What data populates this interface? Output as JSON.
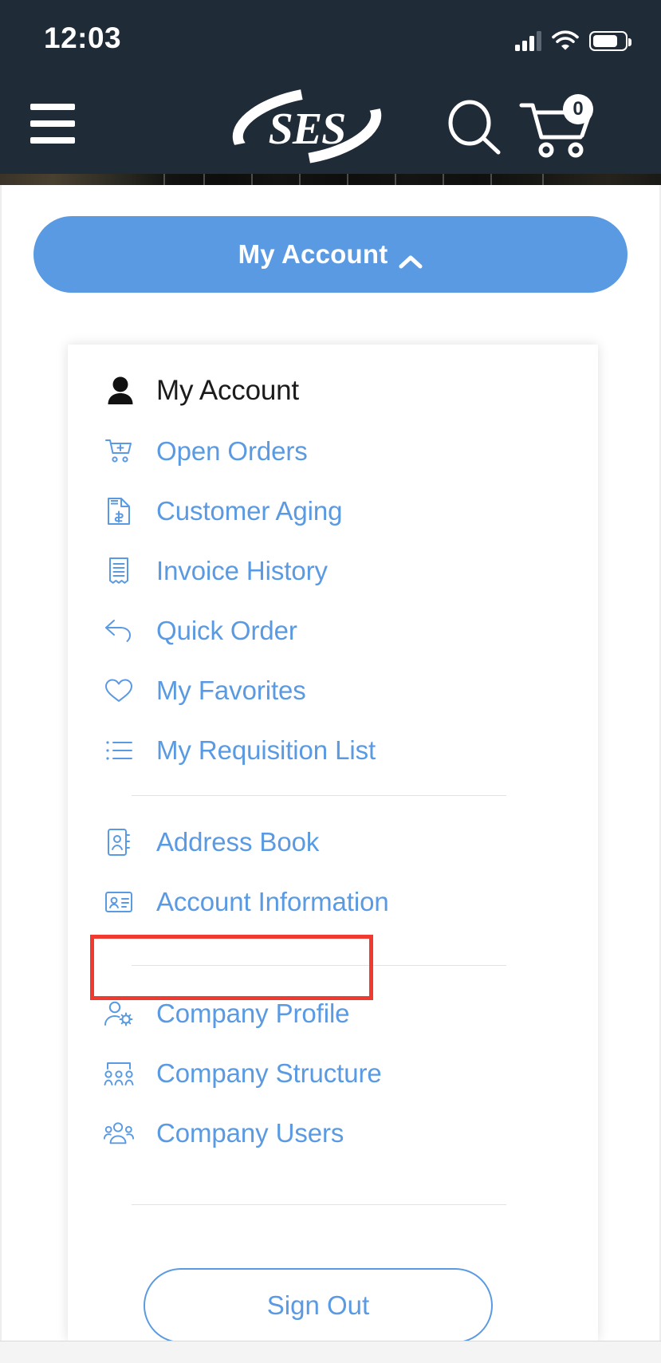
{
  "statusbar": {
    "time": "12:03",
    "signal_icon": "cellular-signal-icon",
    "wifi_icon": "wifi-icon",
    "battery_icon": "battery-icon"
  },
  "header": {
    "menu_icon": "hamburger-menu-icon",
    "logo_text": "SES",
    "search_icon": "search-icon",
    "cart_icon": "shopping-cart-icon",
    "cart_count": "0"
  },
  "account_toggle": {
    "label": "My Account",
    "chevron_icon": "chevron-up-icon",
    "color": "#5a9ae2"
  },
  "menu": {
    "heading": {
      "label": "My Account",
      "icon": "user-solid-icon"
    },
    "groups": [
      {
        "items": [
          {
            "label": "Open Orders",
            "icon": "cart-add-icon"
          },
          {
            "label": "Customer Aging",
            "icon": "document-dollar-icon"
          },
          {
            "label": "Invoice History",
            "icon": "receipt-icon"
          },
          {
            "label": "Quick Order",
            "icon": "reply-arrow-icon"
          },
          {
            "label": "My Favorites",
            "icon": "heart-icon"
          },
          {
            "label": "My Requisition List",
            "icon": "list-icon",
            "highlighted": true
          }
        ]
      },
      {
        "items": [
          {
            "label": "Address Book",
            "icon": "address-book-icon"
          },
          {
            "label": "Account Information",
            "icon": "id-card-icon"
          }
        ]
      },
      {
        "items": [
          {
            "label": "Company Profile",
            "icon": "user-gear-icon"
          },
          {
            "label": "Company Structure",
            "icon": "org-chart-icon"
          },
          {
            "label": "Company Users",
            "icon": "users-group-icon"
          }
        ]
      }
    ],
    "signout_label": "Sign Out",
    "link_color": "#5a9ae2",
    "highlight_color": "#f03a30"
  }
}
